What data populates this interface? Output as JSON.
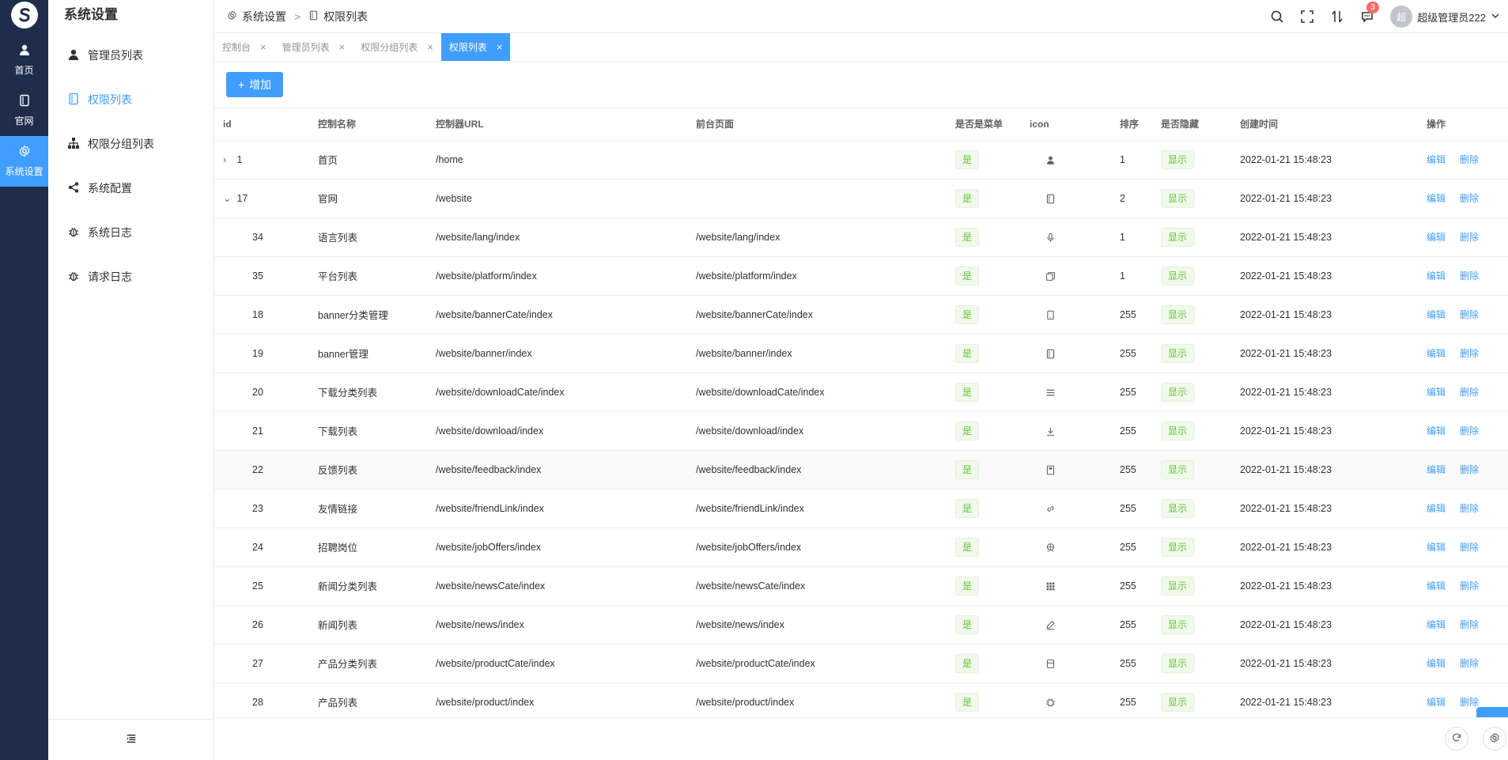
{
  "rail": {
    "items": [
      {
        "label": "首页",
        "icon": "user-icon"
      },
      {
        "label": "官网",
        "icon": "tablet-icon"
      },
      {
        "label": "系统设置",
        "icon": "gear-icon"
      }
    ]
  },
  "sidebar": {
    "title": "系统设置",
    "items": [
      {
        "label": "管理员列表",
        "icon": "user-icon"
      },
      {
        "label": "权限列表",
        "icon": "tablet-icon"
      },
      {
        "label": "权限分组列表",
        "icon": "org-icon"
      },
      {
        "label": "系统配置",
        "icon": "share-icon"
      },
      {
        "label": "系统日志",
        "icon": "bug-icon"
      },
      {
        "label": "请求日志",
        "icon": "bug-icon"
      }
    ]
  },
  "header": {
    "breadcrumb": [
      "系统设置",
      "权限列表"
    ],
    "notification_count": "3",
    "avatar_text": "超",
    "username": "超级管理员222"
  },
  "tabs": [
    {
      "label": "控制台",
      "x": "×"
    },
    {
      "label": "管理员列表",
      "x": "×"
    },
    {
      "label": "权限分组列表",
      "x": "×"
    },
    {
      "label": "权限列表",
      "x": "×"
    }
  ],
  "toolbar": {
    "add_label": "增加",
    "add_icon": "+"
  },
  "table": {
    "columns": [
      "id",
      "控制名称",
      "控制器URL",
      "前台页面",
      "是否是菜单",
      "icon",
      "排序",
      "是否隐藏",
      "创建时间",
      "操作"
    ],
    "edit_label": "编辑",
    "delete_label": "删除",
    "rows": [
      {
        "id": "1",
        "expand": "›",
        "name": "首页",
        "url": "/home",
        "page": "",
        "menu": "是",
        "icon": "user-icon",
        "sort": "1",
        "hidden": "显示",
        "time": "2022-01-21 15:48:23"
      },
      {
        "id": "17",
        "expand": "⌄",
        "name": "官网",
        "url": "/website",
        "page": "",
        "menu": "是",
        "icon": "tablet-icon",
        "sort": "2",
        "hidden": "显示",
        "time": "2022-01-21 15:48:23"
      },
      {
        "id": "34",
        "name": "语言列表",
        "url": "/website/lang/index",
        "page": "/website/lang/index",
        "menu": "是",
        "icon": "microphone-icon",
        "sort": "1",
        "hidden": "显示",
        "time": "2022-01-21 15:48:23"
      },
      {
        "id": "35",
        "name": "平台列表",
        "url": "/website/platform/index",
        "page": "/website/platform/index",
        "menu": "是",
        "icon": "copy-icon",
        "sort": "1",
        "hidden": "显示",
        "time": "2022-01-21 15:48:23"
      },
      {
        "id": "18",
        "name": "banner分类管理",
        "url": "/website/bannerCate/index",
        "page": "/website/bannerCate/index",
        "menu": "是",
        "icon": "phone-icon",
        "sort": "255",
        "hidden": "显示",
        "time": "2022-01-21 15:48:23"
      },
      {
        "id": "19",
        "name": "banner管理",
        "url": "/website/banner/index",
        "page": "/website/banner/index",
        "menu": "是",
        "icon": "tablet-icon",
        "sort": "255",
        "hidden": "显示",
        "time": "2022-01-21 15:48:23"
      },
      {
        "id": "20",
        "name": "下载分类列表",
        "url": "/website/downloadCate/index",
        "page": "/website/downloadCate/index",
        "menu": "是",
        "icon": "menu-icon",
        "sort": "255",
        "hidden": "显示",
        "time": "2022-01-21 15:48:23"
      },
      {
        "id": "21",
        "name": "下载列表",
        "url": "/website/download/index",
        "page": "/website/download/index",
        "menu": "是",
        "icon": "download-icon",
        "sort": "255",
        "hidden": "显示",
        "time": "2022-01-21 15:48:23"
      },
      {
        "id": "22",
        "name": "反馈列表",
        "url": "/website/feedback/index",
        "page": "/website/feedback/index",
        "menu": "是",
        "icon": "notebook-icon",
        "sort": "255",
        "hidden": "显示",
        "time": "2022-01-21 15:48:23"
      },
      {
        "id": "23",
        "name": "友情链接",
        "url": "/website/friendLink/index",
        "page": "/website/friendLink/index",
        "menu": "是",
        "icon": "link-icon",
        "sort": "255",
        "hidden": "显示",
        "time": "2022-01-21 15:48:23"
      },
      {
        "id": "24",
        "name": "招聘岗位",
        "url": "/website/jobOffers/index",
        "page": "/website/jobOffers/index",
        "menu": "是",
        "icon": "basketball-icon",
        "sort": "255",
        "hidden": "显示",
        "time": "2022-01-21 15:48:23"
      },
      {
        "id": "25",
        "name": "新闻分类列表",
        "url": "/website/newsCate/index",
        "page": "/website/newsCate/index",
        "menu": "是",
        "icon": "grid-icon",
        "sort": "255",
        "hidden": "显示",
        "time": "2022-01-21 15:48:23"
      },
      {
        "id": "26",
        "name": "新闻列表",
        "url": "/website/news/index",
        "page": "/website/news/index",
        "menu": "是",
        "icon": "edit-pen-icon",
        "sort": "255",
        "hidden": "显示",
        "time": "2022-01-21 15:48:23"
      },
      {
        "id": "27",
        "name": "产品分类列表",
        "url": "/website/productCate/index",
        "page": "/website/productCate/index",
        "menu": "是",
        "icon": "box-icon",
        "sort": "255",
        "hidden": "显示",
        "time": "2022-01-21 15:48:23"
      },
      {
        "id": "28",
        "name": "产品列表",
        "url": "/website/product/index",
        "page": "/website/product/index",
        "menu": "是",
        "icon": "cpu-icon",
        "sort": "255",
        "hidden": "显示",
        "time": "2022-01-21 15:48:23"
      }
    ]
  }
}
